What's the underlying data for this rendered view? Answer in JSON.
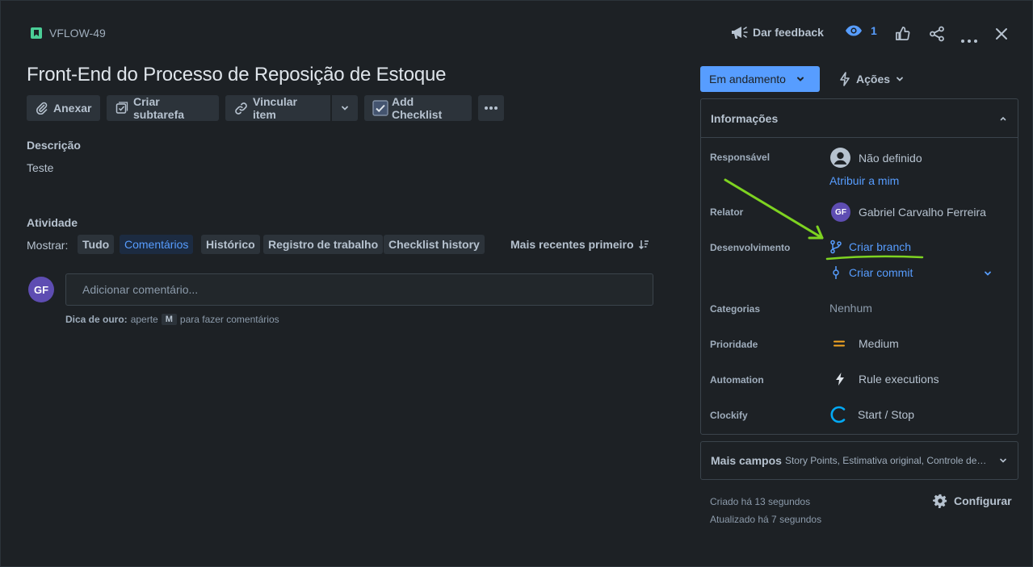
{
  "issue": {
    "key": "VFLOW-49",
    "title": "Front-End do Processo de Reposição de Estoque"
  },
  "toolbar": {
    "attach": "Anexar",
    "subtask": "Criar subtarefa",
    "link_item": "Vincular item",
    "add_checklist": "Add Checklist"
  },
  "description": {
    "label": "Descrição",
    "text": "Teste"
  },
  "activity": {
    "label": "Atividade",
    "show_label": "Mostrar:",
    "filters": [
      "Tudo",
      "Comentários",
      "Histórico",
      "Registro de trabalho",
      "Checklist history"
    ],
    "active_filter": "Comentários",
    "sort": "Mais recentes primeiro"
  },
  "comment": {
    "avatar_initials": "GF",
    "placeholder": "Adicionar comentário...",
    "tip_bold": "Dica de ouro:",
    "tip_pre": "aperte",
    "tip_key": "M",
    "tip_post": "para fazer comentários"
  },
  "header": {
    "feedback": "Dar feedback",
    "watchers": "1"
  },
  "status": {
    "label": "Em andamento",
    "actions": "Ações"
  },
  "info_panel": {
    "title": "Informações",
    "assignee_label": "Responsável",
    "assignee_value": "Não definido",
    "assign_to_me": "Atribuir a mim",
    "reporter_label": "Relator",
    "reporter_initials": "GF",
    "reporter_value": "Gabriel Carvalho Ferreira",
    "dev_label": "Desenvolvimento",
    "create_branch": "Criar branch",
    "create_commit": "Criar commit",
    "categories_label": "Categorias",
    "categories_value": "Nenhum",
    "priority_label": "Prioridade",
    "priority_value": "Medium",
    "automation_label": "Automation",
    "automation_value": "Rule executions",
    "clockify_label": "Clockify",
    "clockify_value": "Start / Stop"
  },
  "more_fields": {
    "title": "Mais campos",
    "subtitle": "Story Points, Estimativa original, Controle de tempo"
  },
  "meta": {
    "created": "Criado há 13 segundos",
    "updated": "Atualizado há 7 segundos",
    "configure": "Configurar"
  },
  "colors": {
    "accent": "#579dff",
    "annotation_arrow": "#7ed321",
    "priority": "#f5a623",
    "clockify": "#03a9f4",
    "avatar": "#5e4db2"
  }
}
